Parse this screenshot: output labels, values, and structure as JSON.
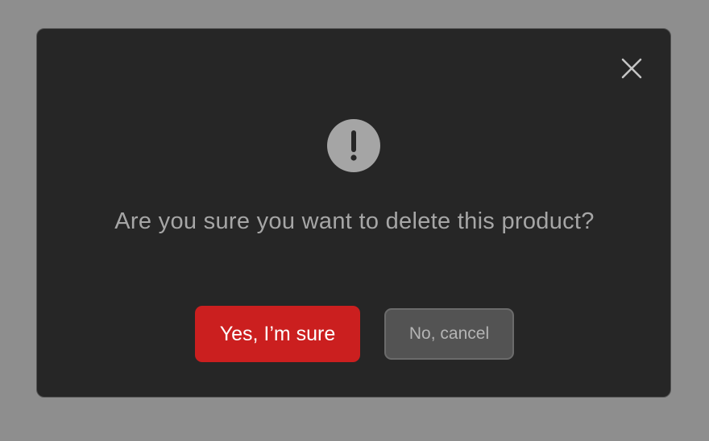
{
  "dialog": {
    "message": "Are you sure you want to delete this product?",
    "confirm_label": "Yes, I’m sure",
    "cancel_label": "No, cancel",
    "close_icon": "close-icon",
    "alert_icon": "exclamation-circle-icon"
  },
  "colors": {
    "backdrop": "#8e8e8e",
    "dialog_background": "#262626",
    "confirm_button": "#cb1f1f",
    "cancel_button": "#535353",
    "message_text": "#a6a6a6"
  }
}
